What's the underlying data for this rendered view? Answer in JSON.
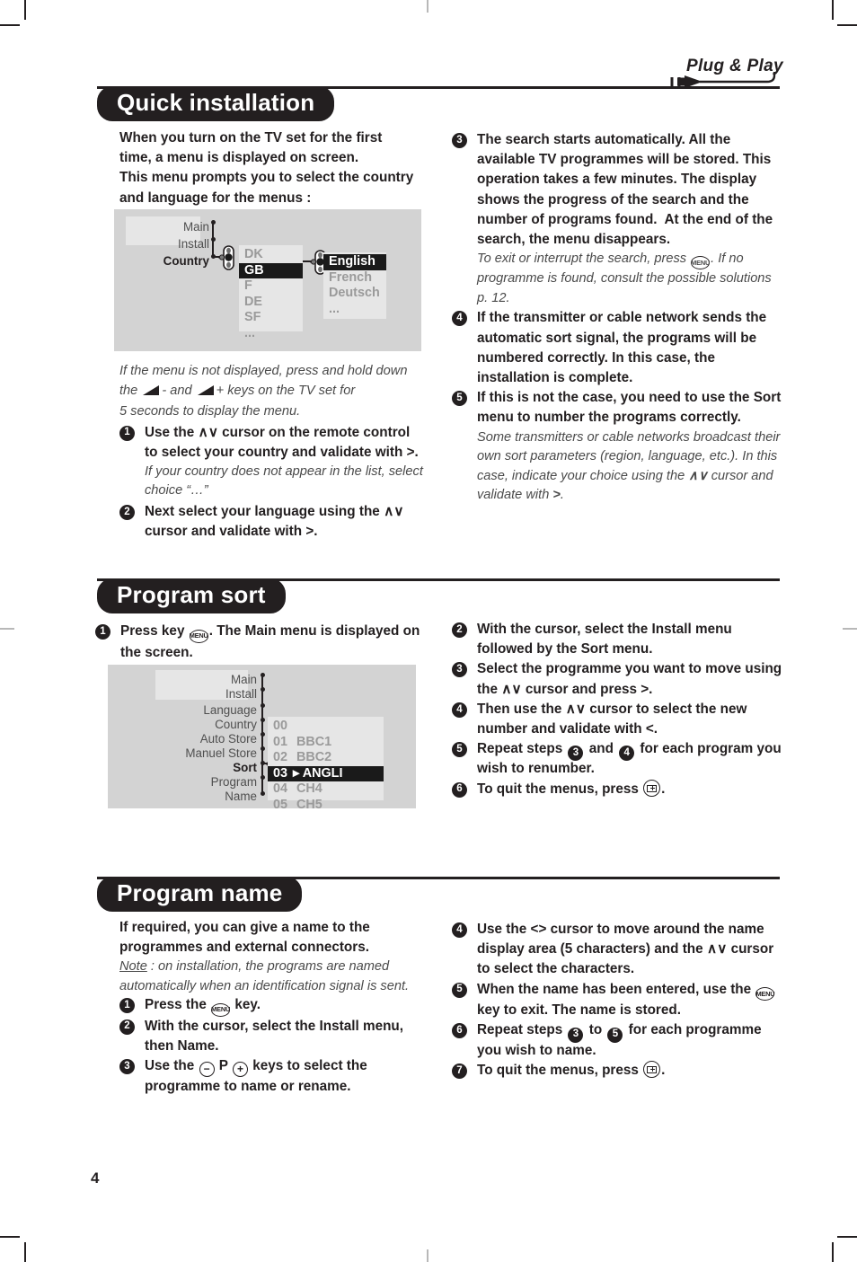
{
  "page": {
    "number": "4",
    "brand_logo": "Plug & Play"
  },
  "sections": [
    {
      "id": "quick-installation",
      "title": "Quick installation",
      "left": {
        "intro": [
          "When you turn on the TV set for the first",
          "time, a menu is displayed on screen.",
          "This menu prompts you to select the country",
          "and language for the menus :"
        ],
        "diagram": {
          "labels": [
            "Main",
            "Install",
            "Country"
          ],
          "country_list": [
            "DK",
            "GB",
            "F",
            "DE",
            "SF",
            "..."
          ],
          "country_selected": "GB",
          "language_list": [
            "English",
            "French",
            "Deutsch",
            "..."
          ],
          "language_selected": "English"
        },
        "note_after_diagram": [
          "If the menu is not displayed, press and hold down",
          "the ◢- and ◢+ keys on the TV set for",
          "5 seconds to display the menu."
        ],
        "steps": [
          {
            "num": "1",
            "bold": "Use the ∧∨ cursor on the remote control to select your country and validate with ＞.",
            "note": "If your country does not appear in the list, select choice “…”"
          },
          {
            "num": "2",
            "bold": "Next select your language using the ∧∨ cursor and validate with ＞.",
            "note": ""
          }
        ]
      },
      "right": {
        "steps": [
          {
            "num": "3",
            "bold": "The search starts automatically. All the available TV programmes will be stored. This operation takes a few minutes. The display shows the progress of the search and the number of programs found. At the end of the search, the menu disappears.",
            "note": "To exit or interrupt the search, press MENU. If no programme is found, consult the possible solutions p. 12."
          },
          {
            "num": "4",
            "bold": "If the transmitter or cable network sends the automatic sort signal, the programs will be numbered correctly. In this case, the installation is complete.",
            "note": ""
          },
          {
            "num": "5",
            "bold": "If this is not the case, you need to use the Sort menu to number the programs correctly.",
            "note": "Some transmitters or cable networks broadcast their own sort parameters (region, language, etc.). In this case, indicate your choice using the ∧∨ cursor and validate with ＞."
          }
        ]
      }
    },
    {
      "id": "program-sort",
      "title": "Program sort",
      "left": {
        "step1": {
          "num": "1",
          "text_a": "Press key",
          "key": "MENU",
          "text_b": ". The",
          "bold": "Main menu",
          "text_c": "is displayed on the screen."
        },
        "diagram": {
          "labels": [
            "Main",
            "Install",
            "Language",
            "Country",
            "Auto Store",
            "Manuel Store",
            "Sort",
            "Program",
            "Name"
          ],
          "label_selected": "Sort",
          "program_rows": [
            {
              "no": "00",
              "name": ""
            },
            {
              "no": "01",
              "name": "BBC1"
            },
            {
              "no": "02",
              "name": "BBC2"
            },
            {
              "no": "03",
              "name": "ANGLI"
            },
            {
              "no": "04",
              "name": "CH4"
            },
            {
              "no": "05",
              "name": "CH5"
            }
          ],
          "program_selected": "03"
        }
      },
      "right": {
        "steps": [
          {
            "num": "2",
            "bold": "With the cursor, select the Install menu followed by the Sort menu."
          },
          {
            "num": "3",
            "bold": "Select the programme you want to move using the ∧∨ cursor and press ＞."
          },
          {
            "num": "4",
            "bold": "Then use the ∧∨ cursor to select the new number and validate with ＜."
          },
          {
            "num": "5",
            "bold": "Repeat steps 3 and 4 for each program you wish to renumber."
          },
          {
            "num": "6",
            "bold": "To quit the menus, press SCREEN-FORMAT."
          }
        ]
      }
    },
    {
      "id": "program-name",
      "title": "Program name",
      "left": {
        "intro": [
          "If required, you can give a name to the",
          "programmes and external connectors."
        ],
        "note": "Note : on installation, the programs are named automatically when an identification signal is sent.",
        "note_underlined_word": "Note",
        "steps": [
          {
            "num": "1",
            "bold": "Press the MENU key."
          },
          {
            "num": "2",
            "bold": "With the cursor, select the Install menu, then Name."
          },
          {
            "num": "3",
            "bold": "Use the − P + keys to select the programme to name or rename."
          }
        ]
      },
      "right": {
        "steps": [
          {
            "num": "4",
            "bold": "Use the ＜＞ cursor to move around the name display area (5 characters) and the ∧∨ cursor to select the characters."
          },
          {
            "num": "5",
            "bold": "When the name has been entered, use the MENU key to exit. The name is stored."
          },
          {
            "num": "6",
            "bold": "Repeat steps 3 to 5 for each programme you wish to name."
          },
          {
            "num": "7",
            "bold": "To quit the menus, press SCREEN-FORMAT."
          }
        ]
      }
    }
  ],
  "labels": {
    "install_bold": "Install",
    "sort_bold": "Sort",
    "name_bold": "Name.",
    "main_menu_bold": "Main menu",
    "p_key": "P"
  },
  "colors": {
    "ink": "#231f20",
    "diagram_bg": "#d3d3d3",
    "panel_bg": "#e6e6e6",
    "muted_text": "#9a9a9a",
    "selected_bg": "#1a1a1a"
  }
}
